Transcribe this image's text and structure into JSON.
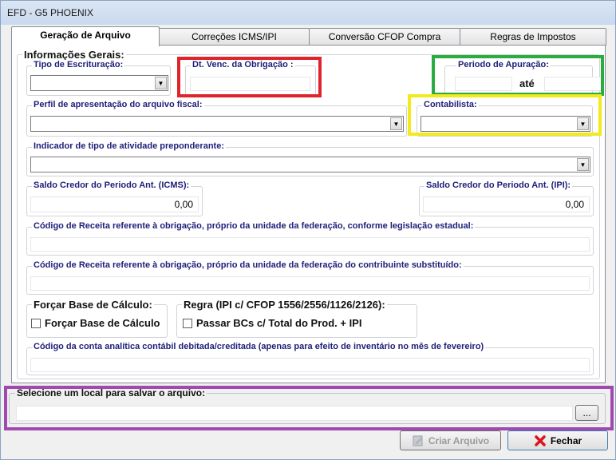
{
  "window": {
    "title": "EFD - G5 PHOENIX"
  },
  "tabs": [
    {
      "label": "Geração de Arquivo"
    },
    {
      "label": "Correções ICMS/IPI"
    },
    {
      "label": "Conversão CFOP Compra"
    },
    {
      "label": "Regras de Impostos"
    }
  ],
  "main": {
    "group_title": "Informações Gerais:",
    "tipo_escrituracao": {
      "label": "Tipo de Escrituração:",
      "value": ""
    },
    "dt_venc": {
      "label": "Dt. Venc. da Obrigação :",
      "value": ""
    },
    "periodo": {
      "label": "Periodo de Apuração:",
      "separator": "até",
      "start": "",
      "end": ""
    },
    "perfil": {
      "label": "Perfil de apresentação do arquivo fiscal:",
      "value": ""
    },
    "contabilista": {
      "label": "Contabilista:",
      "value": ""
    },
    "indicador": {
      "label": "Indicador de tipo de atividade preponderante:",
      "value": ""
    },
    "saldo_icms": {
      "label": "Saldo Credor do Periodo Ant. (ICMS):",
      "value": "0,00"
    },
    "saldo_ipi": {
      "label": "Saldo Credor do Periodo Ant. (IPI):",
      "value": "0,00"
    },
    "cod_receita_uf": {
      "label": "Código de Receita referente à obrigação, próprio da unidade da federação, conforme legislação estadual:",
      "value": ""
    },
    "cod_receita_st": {
      "label": "Código de Receita referente à obrigação, próprio da unidade da federação do contribuinte substituído:",
      "value": ""
    },
    "forcar": {
      "group_label": "Forçar Base de Cálculo:",
      "checkbox_label": "Forçar Base de Cálculo",
      "checked": false
    },
    "regra": {
      "group_label": "Regra (IPI c/ CFOP 1556/2556/1126/2126):",
      "checkbox_label": "Passar BCs c/ Total do Prod. + IPI",
      "checked": false
    },
    "conta": {
      "label": "Código da conta analítica contábil debitada/creditada (apenas para efeito de inventário no mês de fevereiro)",
      "value": ""
    }
  },
  "save": {
    "label": "Selecione um local para salvar o arquivo:",
    "path": "",
    "browse_label": "..."
  },
  "footer": {
    "criar_label": "Criar Arquivo",
    "fechar_label": "Fechar"
  },
  "highlight_colors": {
    "red": "#e0242b",
    "green": "#2bac3e",
    "yellow": "#f2ea1b",
    "purple": "#a04ab0"
  }
}
